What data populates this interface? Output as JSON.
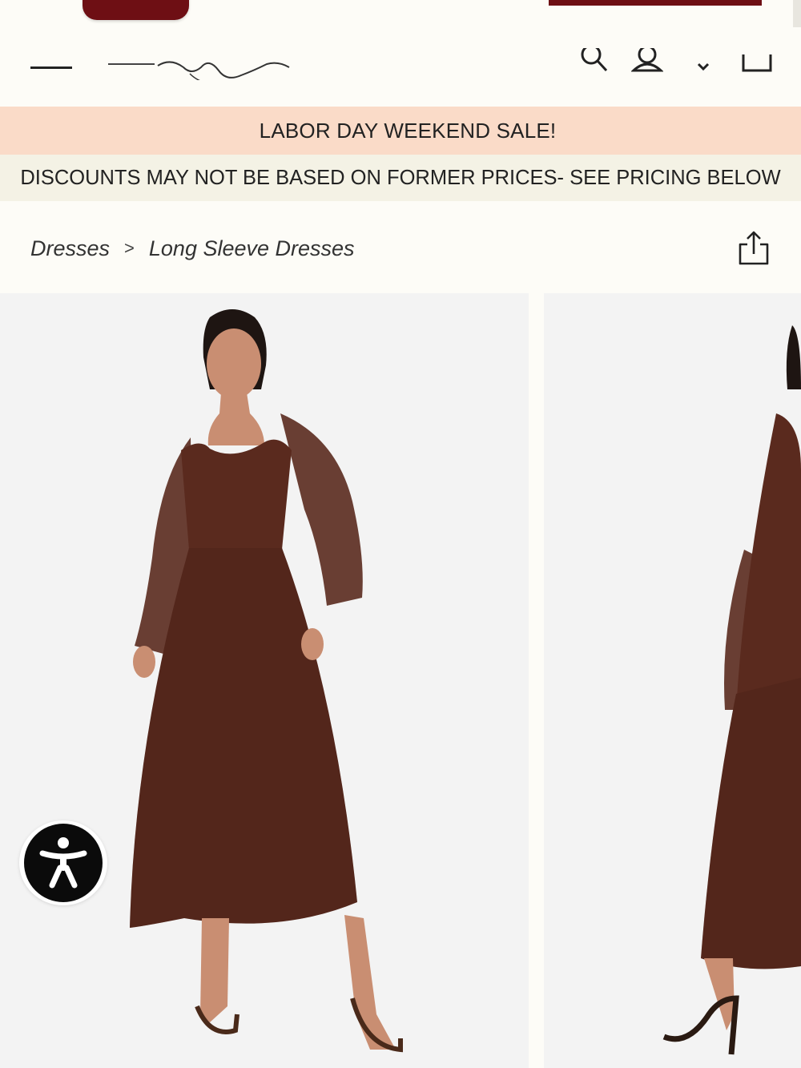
{
  "header": {
    "menu_icon": "hamburger-menu-icon",
    "logo_alt": "brand-logo",
    "icons": [
      "search-icon",
      "account-icon",
      "wishlist-heart-icon",
      "shopping-bag-icon"
    ]
  },
  "banners": {
    "sale": "LABOR DAY WEEKEND SALE!",
    "disclaimer": "DISCOUNTS MAY NOT BE BASED ON FORMER PRICES- SEE PRICING BELOW"
  },
  "breadcrumb": {
    "items": [
      {
        "label": "Dresses"
      },
      {
        "label": "Long Sleeve Dresses"
      }
    ],
    "separator": ">"
  },
  "share": {
    "icon": "share-icon"
  },
  "gallery": {
    "images": [
      {
        "alt": "product-photo-front"
      },
      {
        "alt": "product-photo-side"
      }
    ],
    "dress_color": "#5a2a1e"
  },
  "accessibility": {
    "icon": "accessibility-icon"
  },
  "colors": {
    "accent": "#6e0f14",
    "sale_banner_bg": "#fadbc8",
    "disclaimer_banner_bg": "#f4f2e5",
    "page_bg": "#fdfcf7"
  }
}
